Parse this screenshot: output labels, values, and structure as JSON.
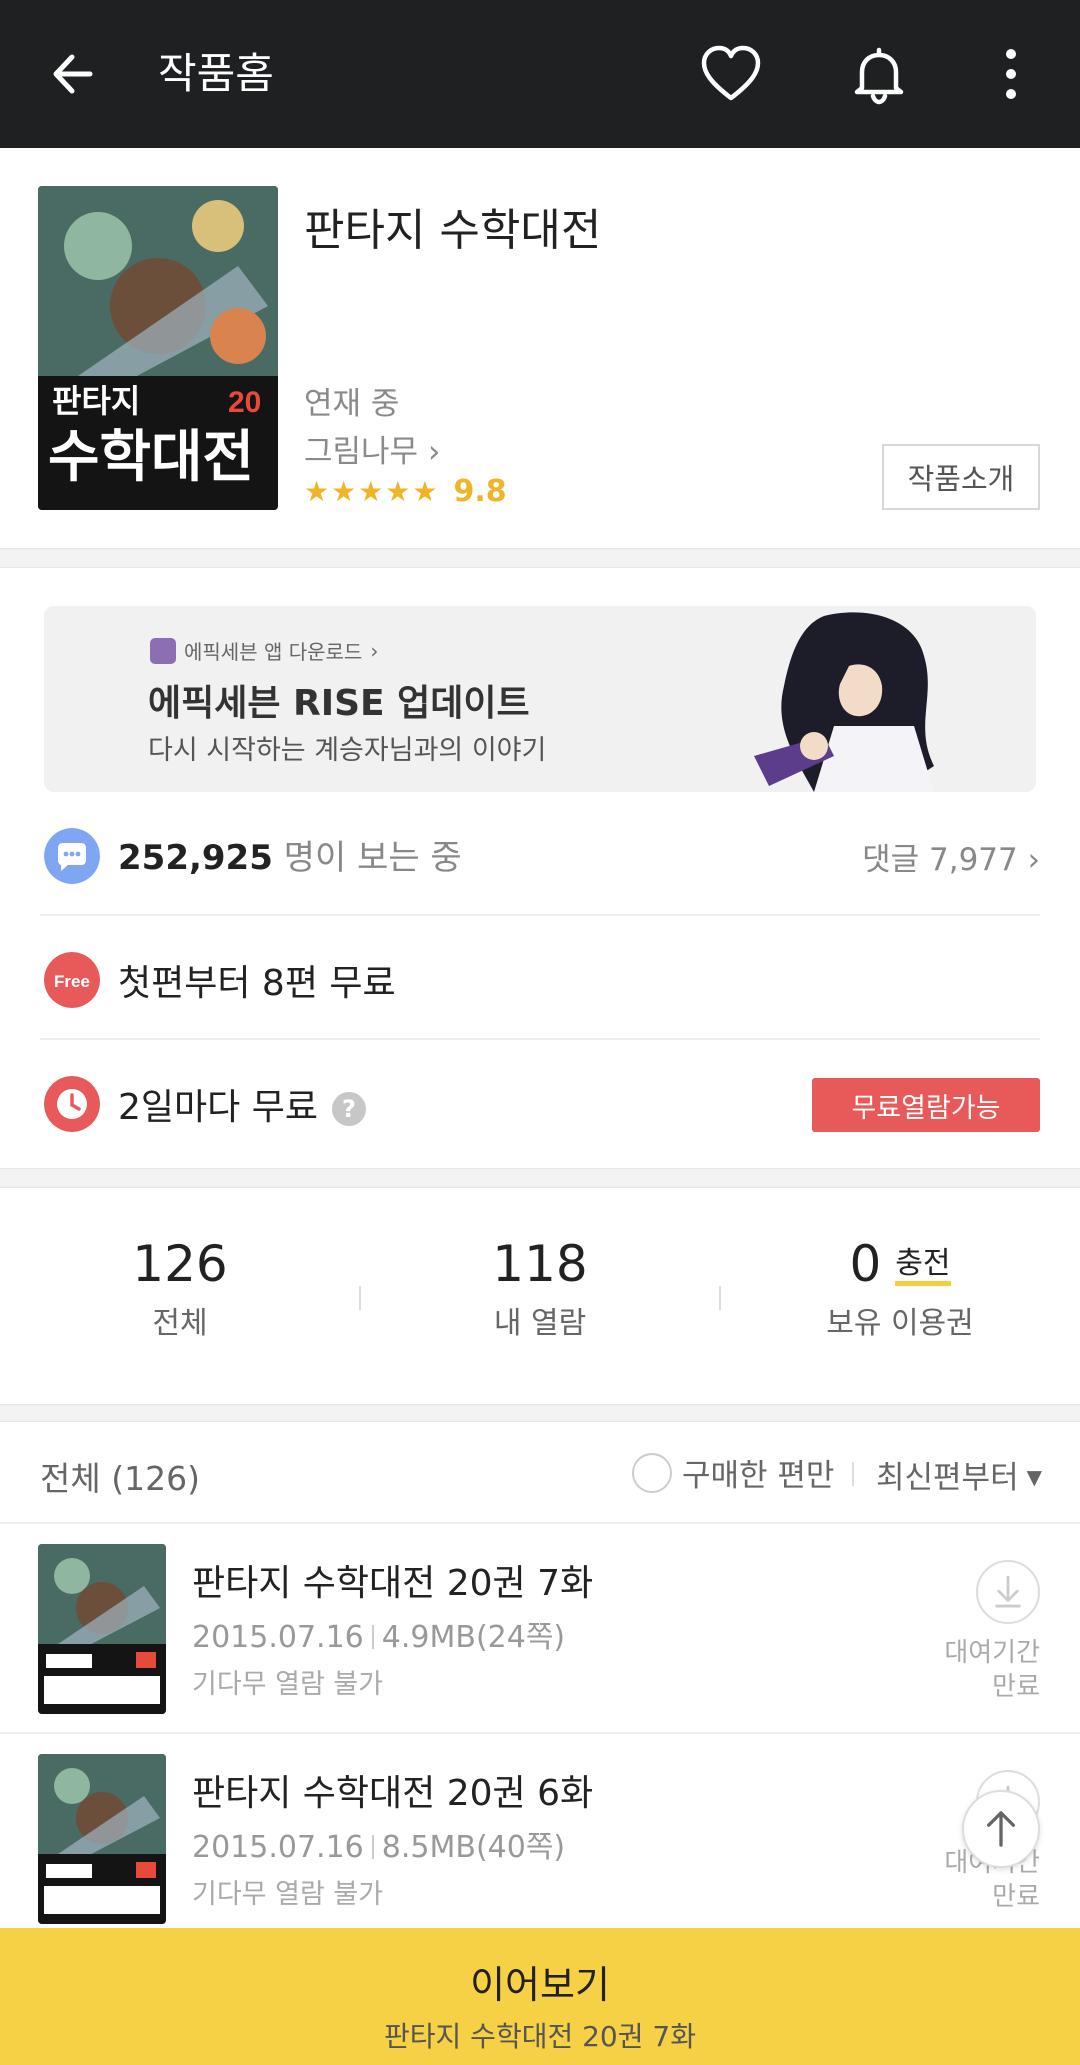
{
  "appbar": {
    "title": "작품홈",
    "icons": [
      "back-arrow-icon",
      "heart-icon",
      "bell-icon",
      "more-vert-icon"
    ]
  },
  "work": {
    "title": "판타지 수학대전",
    "status": "연재 중",
    "author": "그림나무",
    "author_chevron": "›",
    "stars": "★★★★★",
    "rating": "9.8",
    "intro_button": "작품소개",
    "cover": {
      "title_line1": "판타지",
      "title_line2": "수학대전",
      "volume": "20"
    }
  },
  "banner": {
    "app_link": "에픽세븐 앱 다운로드",
    "app_link_chevron": "›",
    "headline": "에픽세븐 RISE 업데이트",
    "subtitle": "다시 시작하는 계승자님과의 이야기"
  },
  "viewers": {
    "count": "252,925",
    "suffix": "명이 보는 중",
    "comments": "댓글 7,977",
    "comments_chevron": "›"
  },
  "free_first": {
    "badge": "Free",
    "text": "첫편부터 8편 무료"
  },
  "wait_free": {
    "text": "2일마다 무료",
    "help": "?",
    "button": "무료열람가능"
  },
  "stats": {
    "total_num": "126",
    "total_label": "전체",
    "read_num": "118",
    "read_label": "내 열람",
    "tickets_num": "0",
    "tickets_charge": "충전",
    "tickets_label": "보유 이용권"
  },
  "list": {
    "all_label": "전체 (126)",
    "owned_only": "구매한 편만",
    "sort": "최신편부터",
    "sort_arrow": "▼",
    "episodes": [
      {
        "title": "판타지 수학대전 20권 7화",
        "date": "2015.07.16",
        "size": "4.9MB(24쪽)",
        "note": "기다무 열람 불가",
        "expire_line1": "대여기간",
        "expire_line2": "만료"
      },
      {
        "title": "판타지 수학대전 20권 6화",
        "date": "2015.07.16",
        "size": "8.5MB(40쪽)",
        "note": "기다무 열람 불가",
        "expire_line1": "대여기간",
        "expire_line2": "만료"
      }
    ]
  },
  "bottom": {
    "label": "이어보기",
    "episode": "판타지 수학대전 20권 7화"
  },
  "colors": {
    "appbar": "#1f2021",
    "accent_yellow": "#f6d045",
    "red": "#e8595a",
    "star": "#f0b429",
    "blue_icon": "#7ea6f2"
  }
}
